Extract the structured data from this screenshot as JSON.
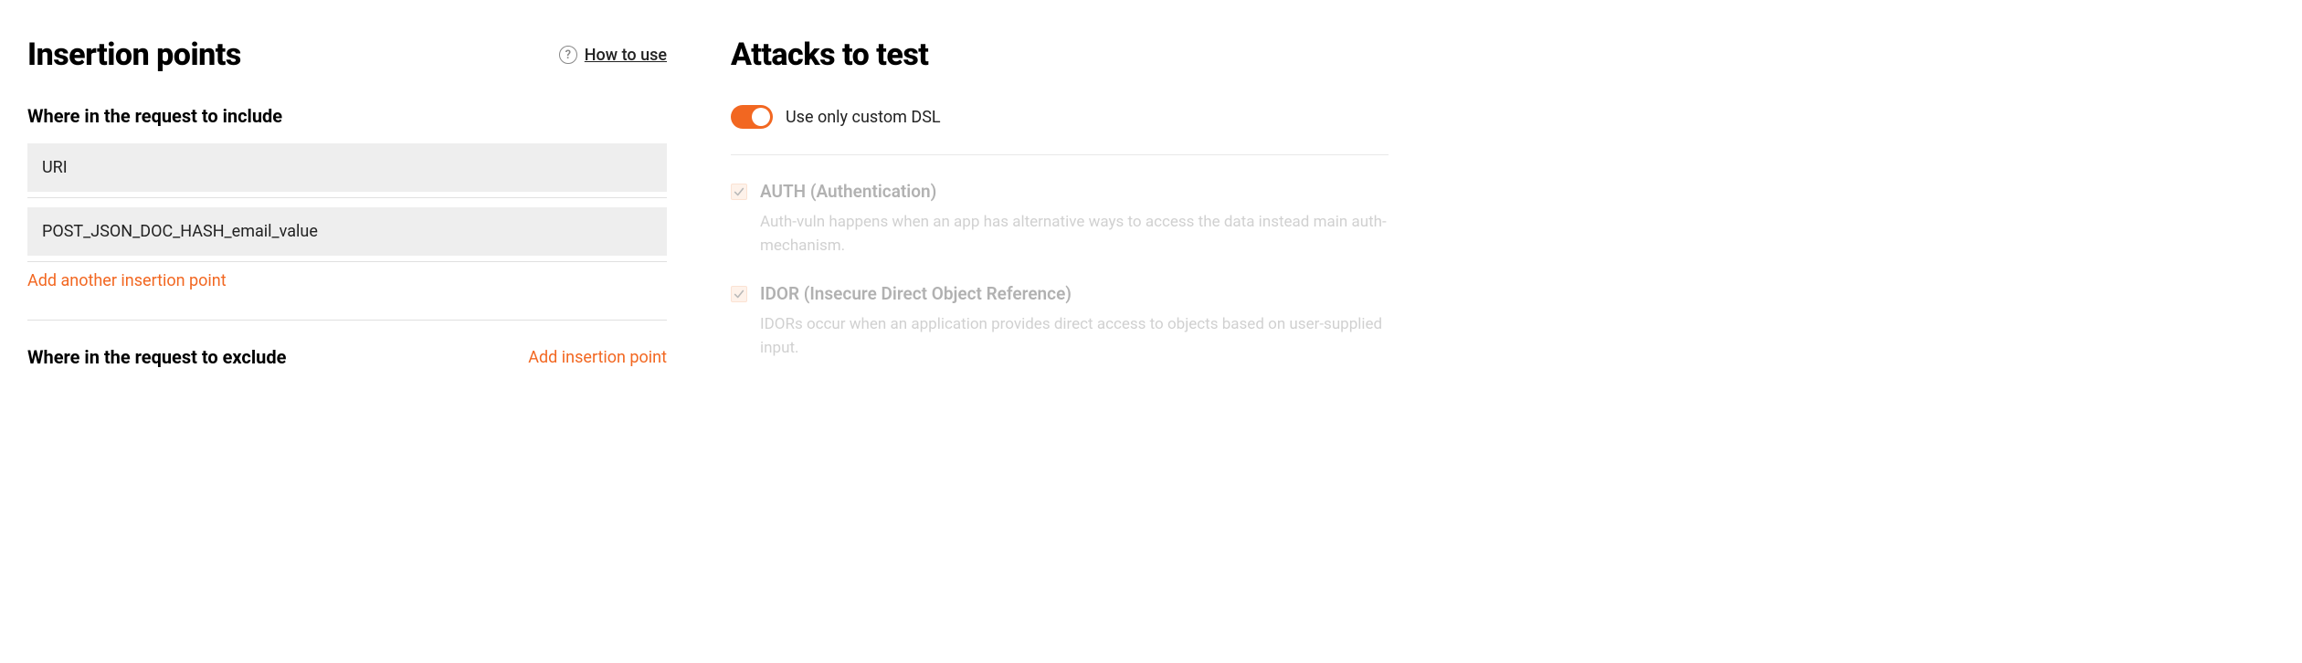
{
  "left": {
    "title": "Insertion points",
    "how_to_use": "How to use",
    "help_glyph": "?",
    "include": {
      "label": "Where in the request to include",
      "items": [
        "URI",
        "POST_JSON_DOC_HASH_email_value"
      ],
      "add_label": "Add another insertion point"
    },
    "exclude": {
      "label": "Where in the request to exclude",
      "add_label": "Add insertion point"
    }
  },
  "right": {
    "title": "Attacks to test",
    "toggle_label": "Use only custom DSL",
    "attacks": [
      {
        "title": "AUTH (Authentication)",
        "desc": "Auth-vuln happens when an app has alternative ways to access the data instead main auth-mechanism."
      },
      {
        "title": "IDOR (Insecure Direct Object Reference)",
        "desc": "IDORs occur when an application provides direct access to objects based on user-supplied input."
      }
    ]
  }
}
